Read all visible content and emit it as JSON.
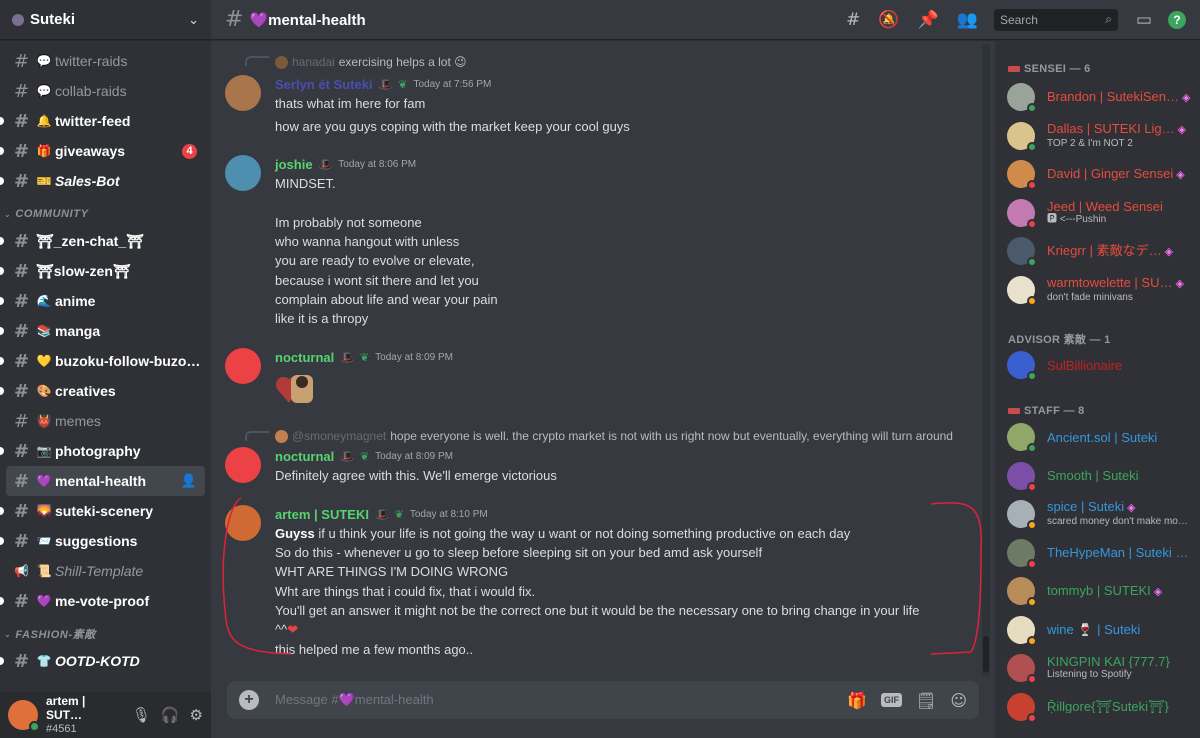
{
  "server": {
    "name": "Suteki"
  },
  "channels_top": [
    {
      "name": "twitter-raids",
      "emoji": "💬",
      "state": "normal"
    },
    {
      "name": "collab-raids",
      "emoji": "💬",
      "state": "normal"
    },
    {
      "name": "twitter-feed",
      "emoji": "🔔",
      "state": "unread"
    },
    {
      "name": "giveaways",
      "emoji": "🎁",
      "state": "unread",
      "badge": "4"
    },
    {
      "name": "Sales-Bot",
      "emoji": "🎫",
      "state": "unread"
    }
  ],
  "category_community": "COMMUNITY",
  "channels_community": [
    {
      "name": "⛩_zen-chat_⛩",
      "emoji": "",
      "state": "unread"
    },
    {
      "name": "⛩slow-zen⛩",
      "emoji": "",
      "state": "unread"
    },
    {
      "name": "anime",
      "emoji": "🌊",
      "state": "unread"
    },
    {
      "name": "manga",
      "emoji": "📚",
      "state": "unread"
    },
    {
      "name": "buzoku-follow-buzo…",
      "emoji": "💛",
      "state": "unread"
    },
    {
      "name": "creatives",
      "emoji": "🎨",
      "state": "unread"
    },
    {
      "name": "memes",
      "emoji": "👹",
      "state": "normal"
    },
    {
      "name": "photography",
      "emoji": "📷",
      "state": "unread"
    },
    {
      "name": "mental-health",
      "emoji": "💜",
      "state": "active"
    },
    {
      "name": "suteki-scenery",
      "emoji": "🌄",
      "state": "unread"
    },
    {
      "name": "suggestions",
      "emoji": "📨",
      "state": "unread"
    },
    {
      "name": "Shill-Template",
      "emoji": "📜",
      "state": "normal",
      "kind": "announce"
    },
    {
      "name": "me-vote-proof",
      "emoji": "💜",
      "state": "unread"
    }
  ],
  "category_fashion": "FASHION-素敵",
  "channels_fashion": [
    {
      "name": "OOTD-KOTD",
      "emoji": "👕",
      "state": "unread"
    }
  ],
  "user_panel": {
    "name": "artem | SUT…",
    "tag": "#4561"
  },
  "topbar": {
    "channel": "💜mental-health",
    "search_placeholder": "Search",
    "help": "?"
  },
  "messages": {
    "m1_reply": {
      "author": "hanadai",
      "text": "exercising helps a lot 😉"
    },
    "m1": {
      "author": "Serlyn ét Suteki",
      "time": "Today at 7:56 PM",
      "lines": [
        "thats what im here for fam",
        "how are you guys coping with the market keep your cool guys"
      ]
    },
    "m2": {
      "author": "joshie",
      "time": "Today at 8:06 PM",
      "lines": [
        "MINDSET.",
        "",
        "Im probably not someone",
        "who wanna hangout with unless",
        "you are ready to evolve or elevate,",
        "because i wont sit there and let you",
        "complain about life and wear your pain",
        "like it is a thropy"
      ]
    },
    "m3": {
      "author": "nocturnal",
      "time": "Today at 8:09 PM"
    },
    "m4_reply": {
      "author": "@smoneymagnet",
      "text": "hope everyone is well. the crypto market is not with us right now but eventually, everything will turn around"
    },
    "m4": {
      "author": "nocturnal",
      "time": "Today at 8:09 PM",
      "lines": [
        "Definitely agree with this. We'll emerge victorious"
      ]
    },
    "m5": {
      "author": "artem | SUTEKI",
      "time": "Today at 8:10 PM",
      "first_bold": "Guyss",
      "first_rest": " if u think your life is not going the way u want or not doing something productive on each day",
      "lines": [
        "So do this - whenever u go to sleep before sleeping sit on your bed amd ask yourself",
        "WHT ARE THINGS I'M DOING WRONG",
        "Wht are things that i could fix, that i would fix.",
        "You'll get an answer it might not be the correct one but it would be the necessary one to bring change in your life"
      ],
      "emote_line": "^^",
      "last_line": "this helped me a few months ago.."
    }
  },
  "composer": {
    "placeholder": "Message #💜mental-health",
    "gif": "GIF"
  },
  "members": {
    "sensei_header": "SENSEI — 6",
    "sensei": [
      {
        "name": "Brandon | SutekiSen…",
        "sub": "",
        "status": "online",
        "color": "#e74c3c",
        "av": "#9aa39a",
        "boost": true
      },
      {
        "name": "Dallas | SUTEKI Lig…",
        "sub": "TOP 2 & I'm NOT 2",
        "status": "online",
        "color": "#e74c3c",
        "av": "#d9c48e",
        "boost": true
      },
      {
        "name": "David | Ginger Sensei",
        "sub": "",
        "status": "dnd",
        "color": "#e74c3c",
        "av": "#d08a4a",
        "boost": true
      },
      {
        "name": "Jeed | Weed Sensei",
        "sub": "🅿 <---Pushin",
        "status": "dnd",
        "color": "#e74c3c",
        "av": "#c47ab0",
        "boost": false
      },
      {
        "name": "Kriegrr | 素敵なデ…",
        "sub": "",
        "status": "online",
        "color": "#e74c3c",
        "av": "#4a5a6a",
        "boost": true
      },
      {
        "name": "warmtowelette | SU…",
        "sub": "don't fade minivans",
        "status": "idle",
        "color": "#e74c3c",
        "av": "#e8e2cc",
        "boost": true
      }
    ],
    "advisor_header": "ADVISOR 素敵 — 1",
    "advisor": [
      {
        "name": "SulBillionaire",
        "sub": "",
        "status": "online",
        "color": "#c91f1f",
        "av": "#3a5fd0",
        "boost": false
      }
    ],
    "staff_header": "STAFF — 8",
    "staff": [
      {
        "name": "Ancient.sol | Suteki",
        "sub": "",
        "status": "online",
        "color": "#3498db",
        "av": "#8fa86a",
        "boost": false
      },
      {
        "name": "Smooth | Suteki",
        "sub": "",
        "status": "dnd",
        "color": "#3ba55d",
        "av": "#7b4ea8",
        "boost": false
      },
      {
        "name": "spice | Suteki",
        "sub": "scared money don't make mon…",
        "status": "idle",
        "color": "#3498db",
        "av": "#a6b0b6",
        "boost": true
      },
      {
        "name": "TheHypeMan | Suteki …",
        "sub": "",
        "status": "dnd",
        "color": "#3498db",
        "av": "#6d7a66",
        "boost": false
      },
      {
        "name": "tommyb | SUTEKI",
        "sub": "",
        "status": "idle",
        "color": "#3ba55d",
        "av": "#b88d5a",
        "boost": true
      },
      {
        "name": "wine 🍷 | Suteki",
        "sub": "",
        "status": "idle",
        "color": "#3498db",
        "av": "#e6dcc0",
        "boost": false
      },
      {
        "name": "KINGPIN KAI {777.7}",
        "sub": "Listening to Spotify",
        "status": "dnd",
        "color": "#3ba55d",
        "av": "#b05050",
        "boost": false
      },
      {
        "name": "Ṝillgore{⛩Suteki⛩}",
        "sub": "",
        "status": "dnd",
        "color": "#3ba55d",
        "av": "#c84030",
        "boost": false
      }
    ]
  },
  "colors": {
    "accent_red": "#ed4245",
    "online": "#3ba55d",
    "highlight": "#e0223a"
  },
  "icons": [
    "threads-icon",
    "mute-icon",
    "pin-icon",
    "members-icon",
    "search-icon",
    "inbox-icon",
    "help-icon"
  ]
}
